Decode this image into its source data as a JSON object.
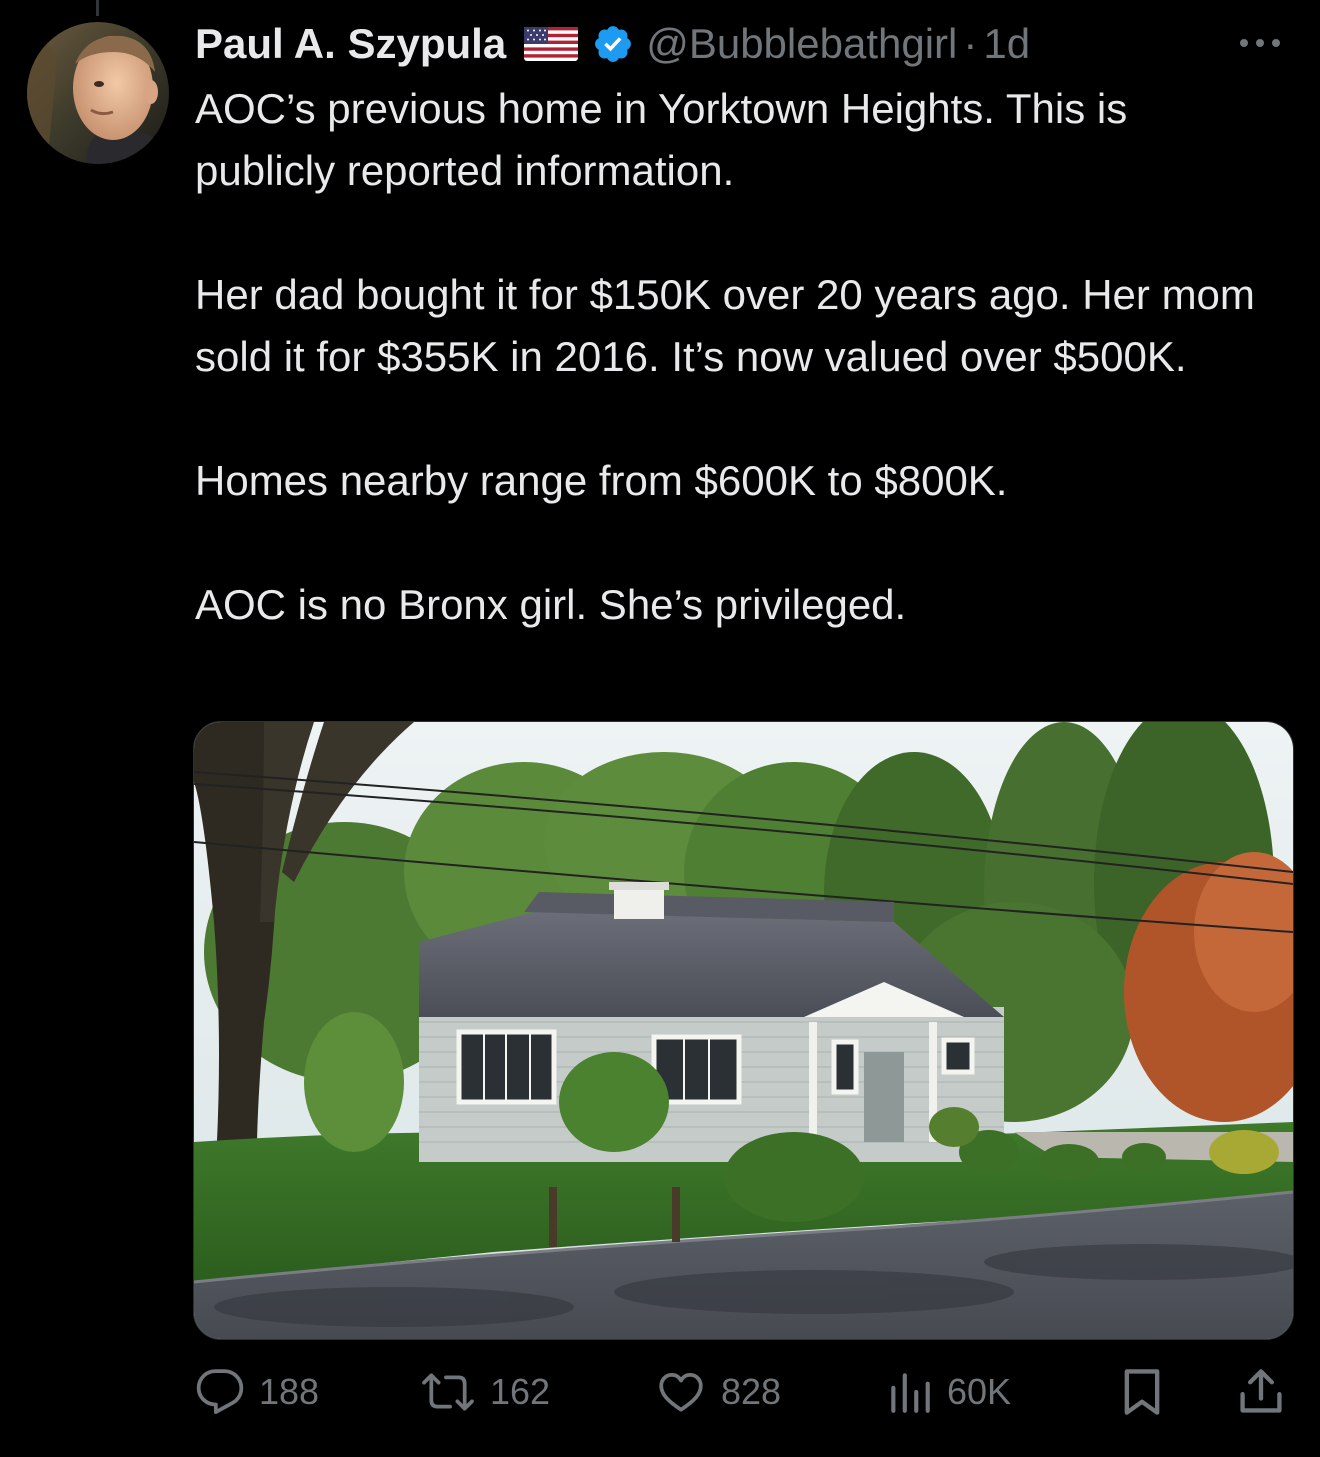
{
  "tweet": {
    "author": {
      "display_name": "Paul A. Szypula",
      "handle": "@Bubblebathgirl",
      "flag_icon": "us-flag-icon",
      "verified_icon": "verified-badge-icon",
      "verified_color": "#1d9bf0"
    },
    "separator": "·",
    "time": "1d",
    "paragraphs": [
      "AOC’s previous home in Yorktown Heights. This is publicly reported information.",
      "Her dad bought it for $150K over 20 years ago. Her mom sold it for $355K in 2016. It’s now valued over $500K.",
      "Homes nearby range from $600K to $800K.",
      "AOC is no Bronx girl. She’s privileged."
    ],
    "actions": {
      "replies": "188",
      "reposts": "162",
      "likes": "828",
      "views": "60K"
    }
  },
  "colors": {
    "background": "#000000",
    "text": "#e7e9ea",
    "secondary": "#71767b",
    "accent": "#1d9bf0"
  }
}
